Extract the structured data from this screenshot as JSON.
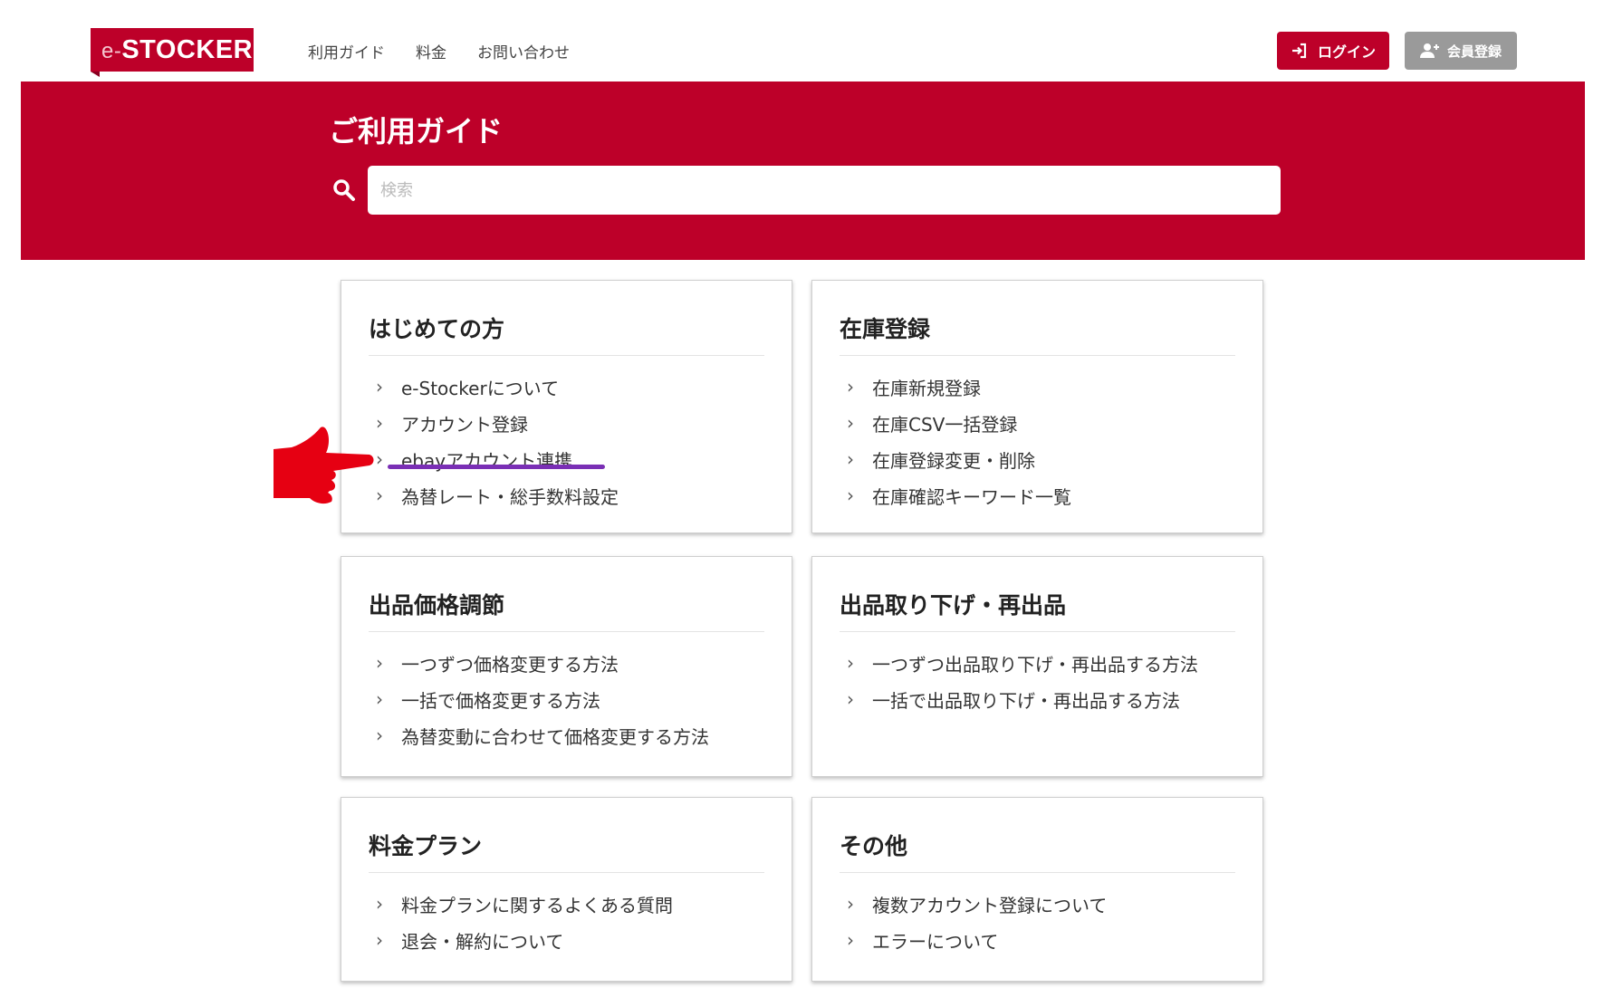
{
  "header": {
    "logo_prefix": "e-",
    "logo_text": "STOCKER",
    "nav": [
      "利用ガイド",
      "料金",
      "お問い合わせ"
    ],
    "login_label": "ログイン",
    "register_label": "会員登録"
  },
  "hero": {
    "title": "ご利用ガイド",
    "search_placeholder": "検索"
  },
  "cards": [
    {
      "title": "はじめての方",
      "items": [
        "e-Stockerについて",
        "アカウント登録",
        "ebayアカウント連携",
        "為替レート・総手数料設定"
      ]
    },
    {
      "title": "在庫登録",
      "items": [
        "在庫新規登録",
        "在庫CSV一括登録",
        "在庫登録変更・削除",
        "在庫確認キーワード一覧"
      ]
    },
    {
      "title": "出品価格調節",
      "items": [
        "一つずつ価格変更する方法",
        "一括で価格変更する方法",
        "為替変動に合わせて価格変更する方法"
      ]
    },
    {
      "title": "出品取り下げ・再出品",
      "items": [
        "一つずつ出品取り下げ・再出品する方法",
        "一括で出品取り下げ・再出品する方法"
      ]
    },
    {
      "title": "料金プラン",
      "items": [
        "料金プランに関するよくある質問",
        "退会・解約について"
      ]
    },
    {
      "title": "その他",
      "items": [
        "複数アカウント登録について",
        "エラーについて"
      ]
    }
  ],
  "colors": {
    "brand": "#bd0029",
    "register_button": "#9a9a9a",
    "annotation_underline": "#7a2fb5",
    "annotation_hand": "#e60012"
  },
  "icons": {
    "login": "login-icon",
    "register": "user-plus-icon",
    "search": "search-icon",
    "item": "chevron-right-icon",
    "annotation": "pointing-hand-icon"
  }
}
